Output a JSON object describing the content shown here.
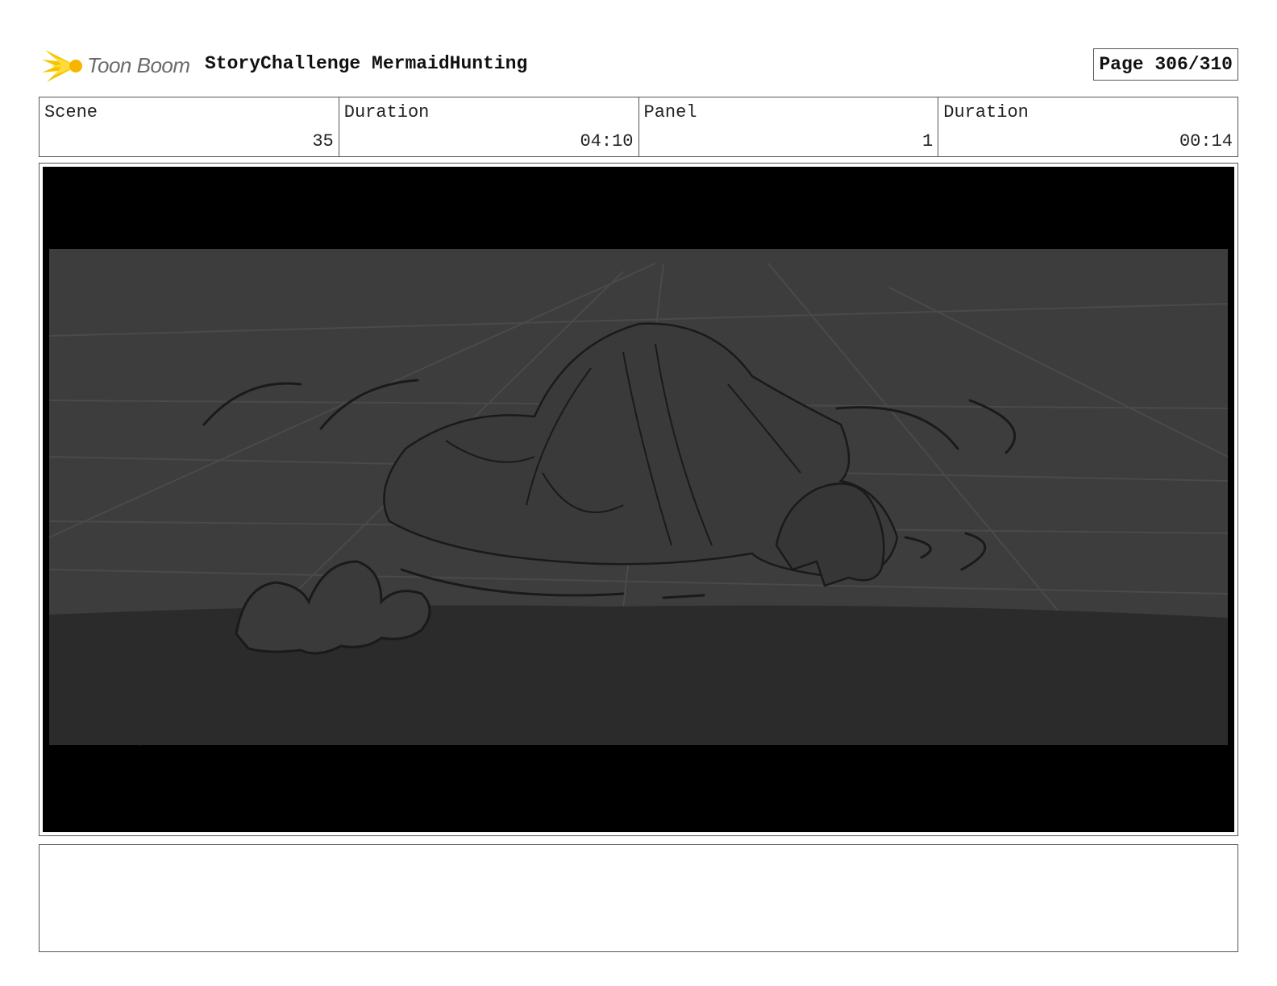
{
  "header": {
    "logo_text": "Toon Boom",
    "project_title": "StoryChallenge MermaidHunting",
    "page_label": "Page 306/310"
  },
  "info": {
    "scene_label": "Scene",
    "scene_value": "35",
    "scene_duration_label": "Duration",
    "scene_duration_value": "04:10",
    "panel_label": "Panel",
    "panel_value": "1",
    "panel_duration_label": "Duration",
    "panel_duration_value": "00:14"
  },
  "notes": {
    "text": ""
  },
  "colors": {
    "logo_yellow": "#f5c400",
    "sketch_background": "#3d3d3d",
    "sketch_floor": "#2b2b2b",
    "letterbox": "#000000"
  }
}
